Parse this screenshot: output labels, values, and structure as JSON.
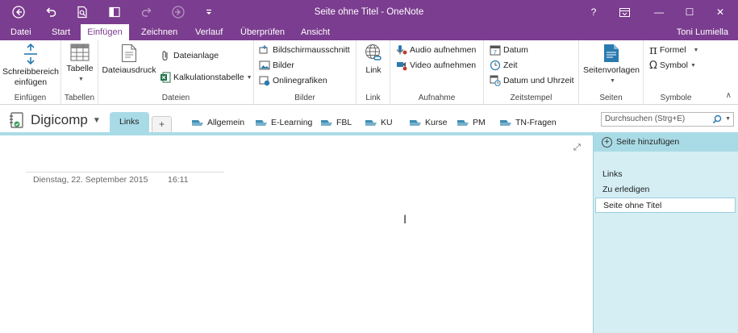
{
  "window": {
    "title": "Seite ohne Titel - OneNote",
    "controls": [
      "?",
      "□",
      "—",
      "☐",
      "✕"
    ]
  },
  "menu": {
    "tabs": [
      "Datei",
      "Start",
      "Einfügen",
      "Zeichnen",
      "Verlauf",
      "Überprüfen",
      "Ansicht"
    ],
    "active": "Einfügen",
    "user": "Toni Lumiella"
  },
  "ribbon": {
    "groups": {
      "einfuegen": "Einfügen",
      "tabellen": "Tabellen",
      "dateien": "Dateien",
      "bilder": "Bilder",
      "link": "Link",
      "aufnahme": "Aufnahme",
      "zeitstempel": "Zeitstempel",
      "seiten": "Seiten",
      "symbole": "Symbole"
    },
    "buttons": {
      "schreibbereich_1": "Schreibbereich",
      "schreibbereich_2": "einfügen",
      "tabelle": "Tabelle",
      "dateiausdruck": "Dateiausdruck",
      "dateianlage": "Dateianlage",
      "kalkulationstabelle": "Kalkulationstabelle",
      "bildschirmausschnitt": "Bildschirmausschnitt",
      "bilder": "Bilder",
      "onlinegrafiken": "Onlinegrafiken",
      "link": "Link",
      "audio": "Audio aufnehmen",
      "video": "Video aufnehmen",
      "datum": "Datum",
      "zeit": "Zeit",
      "datum_uhrzeit": "Datum und Uhrzeit",
      "seitenvorlagen": "Seitenvorlagen",
      "formel": "Formel",
      "symbol": "Symbol"
    }
  },
  "notebook": {
    "name": "Digicomp",
    "sections": {
      "active": "Links",
      "plus": "+"
    },
    "groups": [
      "Allgemein",
      "E-Learning",
      "FBL",
      "KU",
      "Kurse",
      "PM",
      "TN-Fragen"
    ],
    "search_placeholder": "Durchsuchen (Strg+E)"
  },
  "page": {
    "date": "Dienstag, 22. September 2015",
    "time": "16:11"
  },
  "pages_pane": {
    "add_label": "Seite hinzufügen",
    "pages": [
      "Links",
      "Zu erledigen",
      "Seite ohne Titel"
    ],
    "selected": "Seite ohne Titel"
  },
  "colors": {
    "brand": "#7b3d8f",
    "section_teal": "#a9dbe6",
    "pane_bg": "#d4eef4",
    "group_icon": "#3d8fb3"
  }
}
